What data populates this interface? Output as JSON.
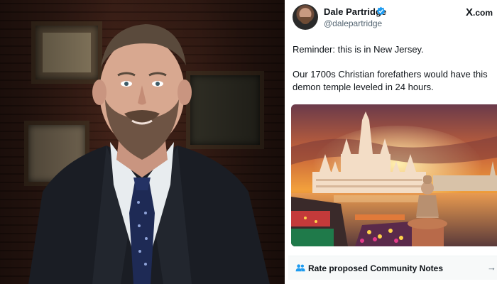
{
  "tweet": {
    "display_name": "Dale Partridge",
    "handle": "@dalepartridge",
    "platform_logo": "X",
    "platform_logo_suffix": ".com",
    "lines": [
      "Reminder: this is in New Jersey.",
      "Our 1700s Christian forefathers would have this demon temple leveled in 24 hours."
    ],
    "verified_color": "#1d9bf0"
  },
  "community_notes": {
    "label": "Rate proposed Community Notes",
    "icon": "people-icon",
    "action_icon": "arrow-right-icon"
  },
  "colors": {
    "text": "#0f1419",
    "secondary_text": "#536471",
    "notes_bar_bg": "#f7f9f9"
  }
}
